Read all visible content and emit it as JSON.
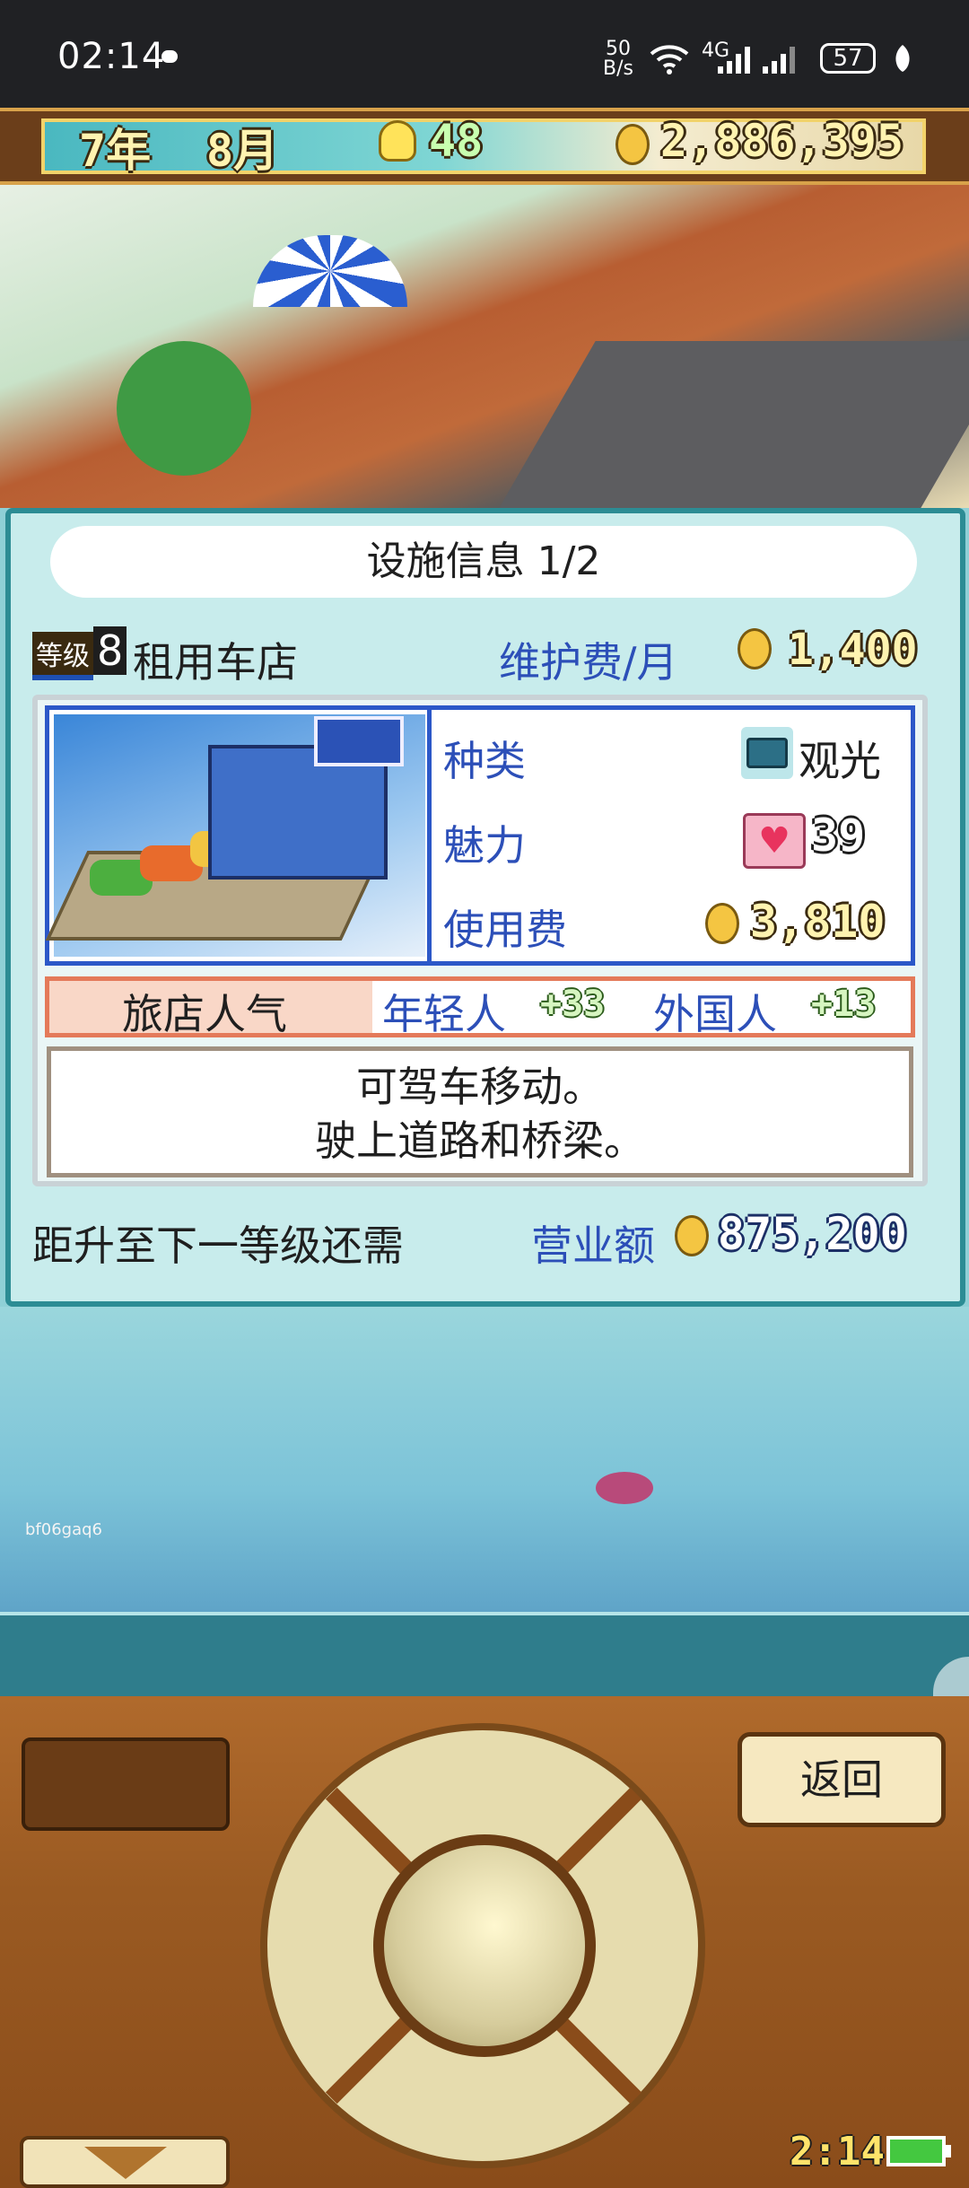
{
  "status_bar": {
    "time": "02:14",
    "net_speed_value": "50",
    "net_speed_unit": "B/s",
    "network_type": "4G",
    "battery": "57"
  },
  "game_header": {
    "year": "7年",
    "month": "8月",
    "ideas": "48",
    "money": "2,886,395"
  },
  "facility": {
    "title": "设施信息 1/2",
    "level_badge": "等级",
    "level": "8",
    "name": "租用车店",
    "upkeep_label": "维护费/月",
    "upkeep_value": "1,400",
    "type_label": "种类",
    "type_value": "观光",
    "charm_label": "魅力",
    "charm_value": "39",
    "fee_label": "使用费",
    "fee_value": "3,810",
    "popularity_label": "旅店人气",
    "young_label": "年轻人",
    "young_value": "33",
    "foreign_label": "外国人",
    "foreign_value": "13",
    "description_line1": "可驾车移动。",
    "description_line2": "驶上道路和桥梁。",
    "next_level_label": "距升至下一等级还需",
    "sales_label": "营业额",
    "sales_value": "875,200"
  },
  "watermark": "bf06gaq6",
  "controls": {
    "back_label": "返回",
    "clock": "2:14"
  },
  "icons": {
    "idea": "lightbulb-icon",
    "coin": "coin-icon",
    "type": "camera-icon",
    "charm": "heart-icon"
  }
}
